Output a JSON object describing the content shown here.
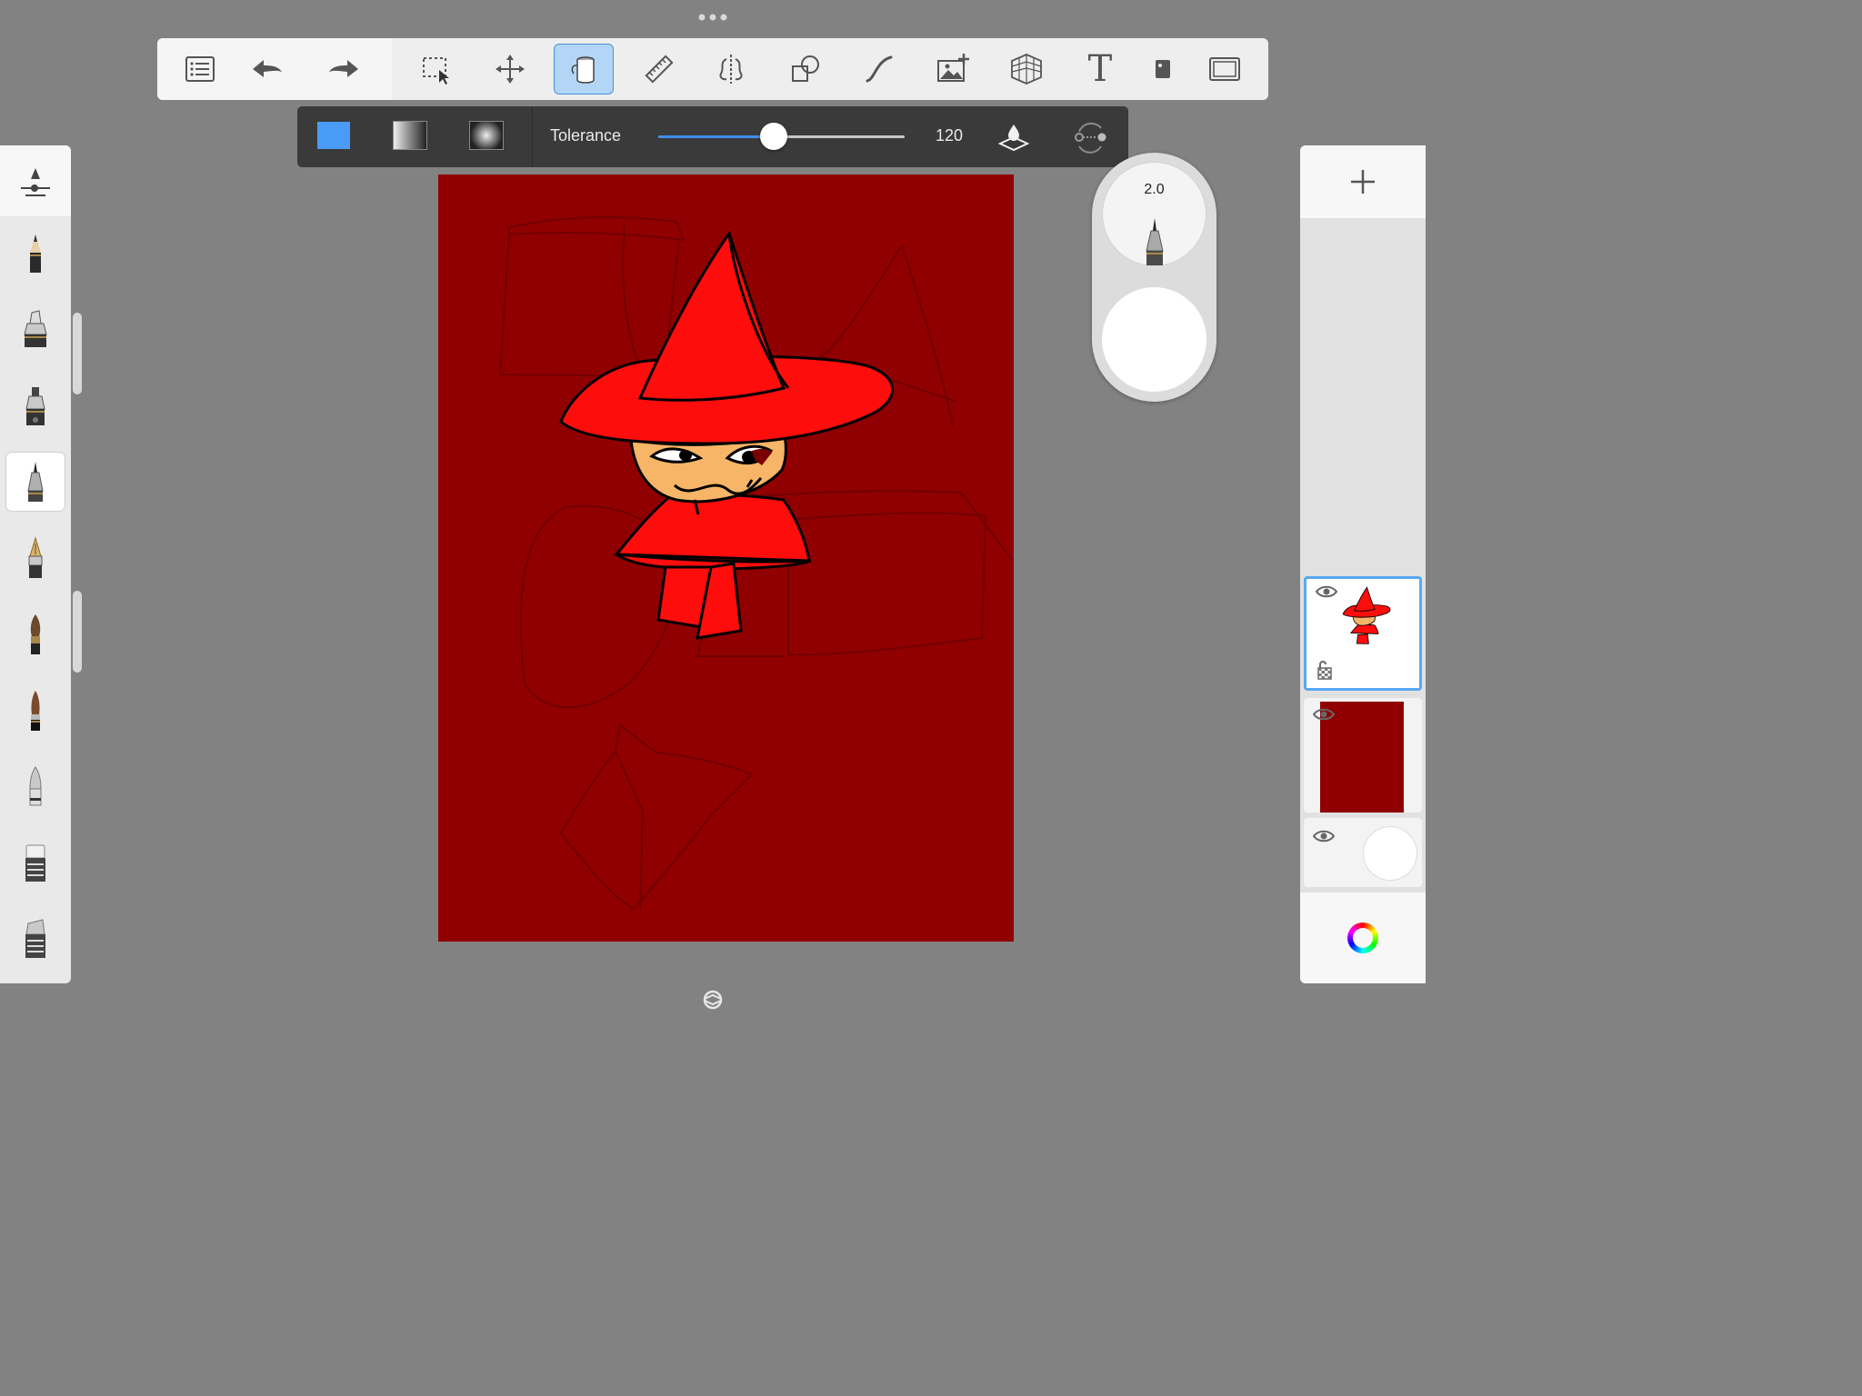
{
  "top_toolbar": {
    "tools": [
      {
        "name": "list",
        "icon": "list-icon"
      },
      {
        "name": "undo",
        "icon": "undo-icon"
      },
      {
        "name": "redo",
        "icon": "redo-icon"
      },
      {
        "name": "selection",
        "icon": "selection-icon"
      },
      {
        "name": "transform",
        "icon": "move-icon"
      },
      {
        "name": "fill",
        "icon": "paint-bucket-icon",
        "active": true
      },
      {
        "name": "ruler",
        "icon": "ruler-icon"
      },
      {
        "name": "symmetry",
        "icon": "symmetry-icon"
      },
      {
        "name": "shapes",
        "icon": "shapes-icon"
      },
      {
        "name": "curve",
        "icon": "curve-icon"
      },
      {
        "name": "add-image",
        "icon": "add-image-icon"
      },
      {
        "name": "perspective",
        "icon": "perspective-grid-icon"
      },
      {
        "name": "text",
        "icon": "text-icon",
        "glyph": "T"
      },
      {
        "name": "stamp",
        "icon": "stamp-icon"
      },
      {
        "name": "fullscreen",
        "icon": "fullscreen-icon"
      }
    ]
  },
  "fill_bar": {
    "modes": [
      "solid",
      "linear-gradient",
      "radial-gradient"
    ],
    "active_mode": "solid",
    "solid_color": "#4a9bf5",
    "tolerance_label": "Tolerance",
    "tolerance_value": "120",
    "tolerance_fraction": 0.47
  },
  "puck": {
    "size_value": "2.0"
  },
  "brushes": {
    "items": [
      "pencil",
      "marker",
      "chisel-marker",
      "ballpoint-pen",
      "fountain-pen",
      "paintbrush",
      "ink-brush",
      "airbrush",
      "eraser",
      "hard-eraser"
    ],
    "active_index": 3
  },
  "layers": {
    "count": 3,
    "active_index": 0
  },
  "colors": {
    "canvas_background": "#900000",
    "hat_red": "#ff0d0d",
    "skin": "#f6b567",
    "accent_blue": "#4a9bf5"
  }
}
